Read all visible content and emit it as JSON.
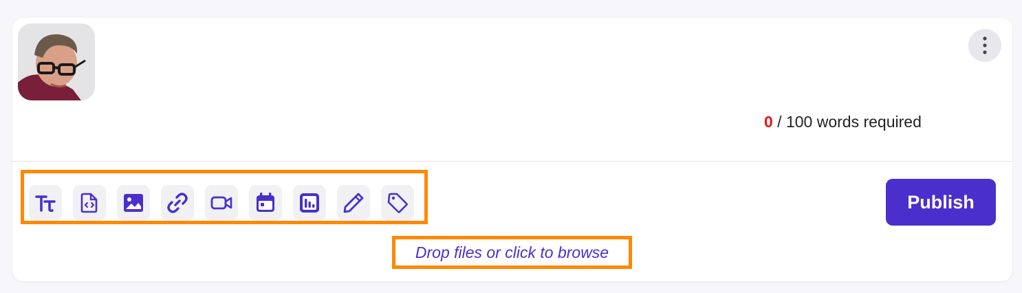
{
  "user": {
    "avatar_icon": "user-avatar-photo"
  },
  "menu": {
    "icon": "more-vertical-icon"
  },
  "word_count": {
    "current": "0",
    "rest": " / 100 words required",
    "current_color": "#e8121a"
  },
  "toolbar": {
    "items": [
      {
        "icon": "text-format-icon"
      },
      {
        "icon": "code-file-icon"
      },
      {
        "icon": "image-icon"
      },
      {
        "icon": "link-icon"
      },
      {
        "icon": "video-icon"
      },
      {
        "icon": "calendar-icon"
      },
      {
        "icon": "chart-icon"
      },
      {
        "icon": "pencil-icon"
      },
      {
        "icon": "tag-icon"
      }
    ]
  },
  "publish": {
    "label": "Publish"
  },
  "dropzone": {
    "label": "Drop files or click to browse"
  },
  "colors": {
    "accent": "#4a2fcc",
    "highlight": "#ff8800",
    "background": "#f6f6fb"
  }
}
